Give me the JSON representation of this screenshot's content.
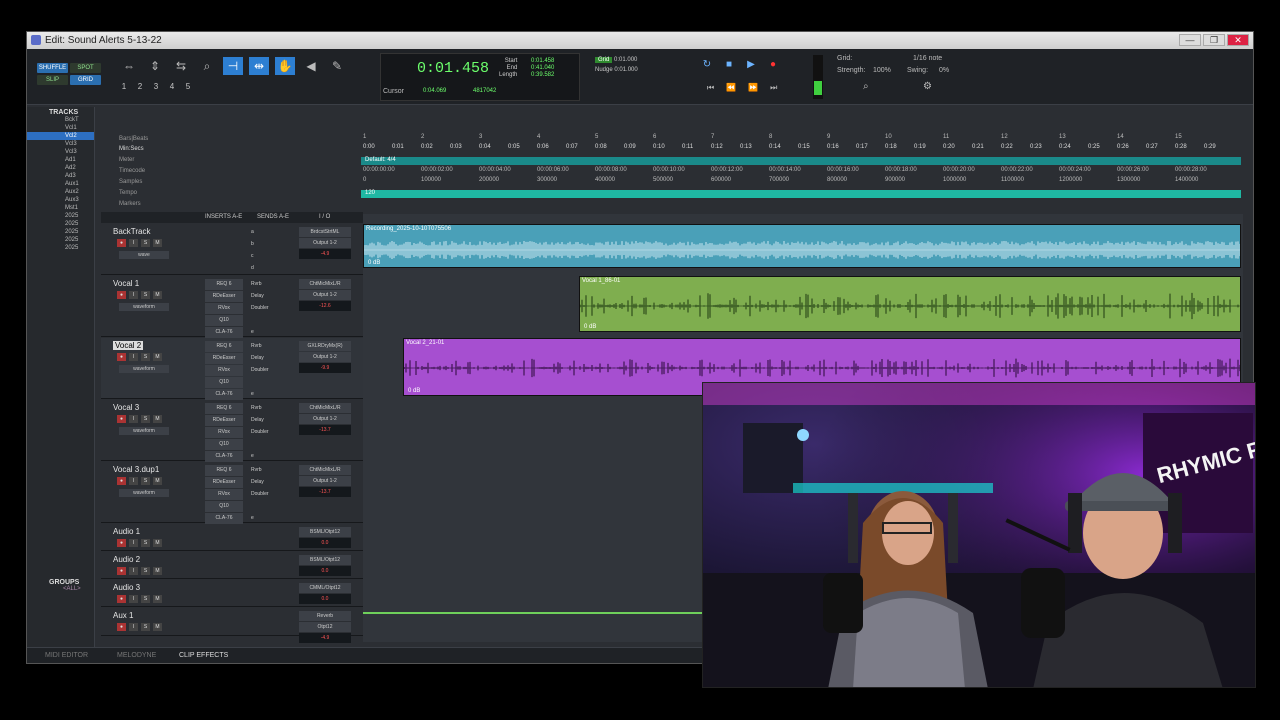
{
  "window": {
    "title": "Edit: Sound Alerts 5-13-22",
    "controls": [
      "—",
      "❐",
      "✕"
    ]
  },
  "toolbar": {
    "modes": [
      "SHUFFLE",
      "SPOT",
      "SLIP",
      "GRID"
    ],
    "main_counter": "0:01.458",
    "cursor_label": "Cursor",
    "cursor_value": "0:04.069",
    "cursor_sample": "4817042",
    "selection_labels": [
      "Start",
      "End",
      "Length"
    ],
    "selection_values": [
      "0:01.458",
      "0:41.040",
      "0:39.582"
    ],
    "grid_label": "Grid",
    "grid_value": "0:01.000",
    "nudge_label": "Nudge",
    "nudge_value": "0:01.000",
    "quick_grid": "Grid:",
    "note_value": "1/16 note",
    "strength_label": "Strength:",
    "strength_value": "100%",
    "swing_label": "Swing:",
    "swing_value": "0%",
    "zoom_presets": [
      "1",
      "2",
      "3",
      "4",
      "5"
    ]
  },
  "tracks_panel": {
    "title": "TRACKS",
    "items": [
      "BckT",
      "Vcl1",
      "Vcl2",
      "Vcl3",
      "Vcl3",
      "Ad1",
      "Ad2",
      "Ad3",
      "Aux1",
      "Aux2",
      "Aux3",
      "Mst1",
      "2025",
      "2025",
      "2025",
      "2025",
      "2025"
    ],
    "groups_title": "GROUPS",
    "groups_all": "<ALL>"
  },
  "rulers": {
    "labels": [
      "Bars|Beats",
      "Min:Secs",
      "Meter",
      "Timecode",
      "Samples",
      "Tempo",
      "Markers"
    ],
    "meter_value": "Default: 4/4",
    "tempo_value": "120",
    "bars": [
      "1",
      "2",
      "3",
      "4",
      "5",
      "6",
      "7",
      "8",
      "9",
      "10",
      "11",
      "12",
      "13",
      "14",
      "15"
    ],
    "minsecs": [
      "0:00",
      "0:01",
      "0:02",
      "0:03",
      "0:04",
      "0:05",
      "0:06",
      "0:07",
      "0:08",
      "0:09",
      "0:10",
      "0:11",
      "0:12",
      "0:13",
      "0:14",
      "0:15",
      "0:16",
      "0:17",
      "0:18",
      "0:19",
      "0:20",
      "0:21",
      "0:22",
      "0:23",
      "0:24",
      "0:25",
      "0:26",
      "0:27",
      "0:28",
      "0:29"
    ],
    "timecode": [
      "00:00:00:00",
      "00:00:02:00",
      "00:00:04:00",
      "00:00:06:00",
      "00:00:08:00",
      "00:00:10:00",
      "00:00:12:00",
      "00:00:14:00",
      "00:00:16:00",
      "00:00:18:00",
      "00:00:20:00",
      "00:00:22:00",
      "00:00:24:00",
      "00:00:26:00",
      "00:00:28:00"
    ],
    "samples": [
      "0",
      "100000",
      "200000",
      "300000",
      "400000",
      "500000",
      "600000",
      "700000",
      "800000",
      "900000",
      "1000000",
      "1100000",
      "1200000",
      "1300000",
      "1400000"
    ]
  },
  "mix_header": {
    "inserts": "INSERTS A-E",
    "sends": "SENDS A-E",
    "io": "I / O"
  },
  "tracks": [
    {
      "name": "BackTrack",
      "view": "wave",
      "inserts": [],
      "sends": [
        "a",
        "b",
        "c",
        "d"
      ],
      "io": [
        "BrdcstStrtML",
        "Output 1-2"
      ],
      "vol": "-4.9",
      "pan": "100 100"
    },
    {
      "name": "Vocal 1",
      "view": "waveform",
      "auto": "dyn read",
      "inserts": [
        "REQ 6",
        "RDeEsser",
        "RVox",
        "Q10",
        "CLA-76"
      ],
      "sends": [
        "Rvrb",
        "Delay",
        "Doubler",
        "",
        "e"
      ],
      "io": [
        "ChtMicMixL/R",
        "Output 1-2"
      ],
      "vol": "-12.6",
      "pan": "100 100"
    },
    {
      "name": "Vocal 2",
      "view": "waveform",
      "auto": "dyn read",
      "inserts": [
        "REQ 6",
        "RDeEsser",
        "RVox",
        "Q10",
        "CLA-76"
      ],
      "sends": [
        "Rvrb",
        "Delay",
        "Doubler",
        "",
        "e"
      ],
      "io": [
        "GXLRDryMx(R)",
        "Output 1-2"
      ],
      "vol": "-9.9",
      "pan": "pan"
    },
    {
      "name": "Vocal 3",
      "view": "waveform",
      "auto": "dyn read",
      "inserts": [
        "REQ 6",
        "RDeEsser",
        "RVox",
        "Q10",
        "CLA-76"
      ],
      "sends": [
        "Rvrb",
        "Delay",
        "Doubler",
        "",
        "e"
      ],
      "io": [
        "ChtMicMixL/R",
        "Output 1-2"
      ],
      "vol": "-13.7",
      "pan": "100 100"
    },
    {
      "name": "Vocal 3.dup1",
      "view": "waveform",
      "auto": "dyn read",
      "inserts": [
        "REQ 6",
        "RDeEsser",
        "RVox",
        "Q10",
        "CLA-76"
      ],
      "sends": [
        "Rvrb",
        "Delay",
        "Doubler",
        "",
        "e"
      ],
      "io": [
        "ChtMicMixL/R",
        "Output 1-2"
      ],
      "vol": "-13.7",
      "pan": "100 100"
    },
    {
      "name": "Audio 1",
      "view": "wave",
      "io": [
        "BSML/Otpt12"
      ],
      "vol": "0.0"
    },
    {
      "name": "Audio 2",
      "view": "wave",
      "io": [
        "BSML/Otpt12"
      ],
      "vol": "0.0"
    },
    {
      "name": "Audio 3",
      "view": "wave",
      "io": [
        "CMML/Otpt12"
      ],
      "vol": "0.0"
    },
    {
      "name": "Aux 1",
      "view": "vol",
      "io": [
        "Reverb",
        "Otpt12"
      ],
      "vol": "-4.9"
    }
  ],
  "clips": [
    {
      "name": "Recording_2025-10-10T075506",
      "gain": "0 dB",
      "color": "#4aa0b8"
    },
    {
      "name": "Vocal 1_86-01",
      "gain": "0 dB",
      "color": "#7fae4f"
    },
    {
      "name": "Vocal 2_21-01",
      "gain": "0 dB",
      "color": "#a64fd0"
    }
  ],
  "bottom_tabs": [
    "MIDI EDITOR",
    "MELODYNE",
    "CLIP EFFECTS"
  ],
  "colors": {
    "accent": "#2d7fd2",
    "counter_green": "#6cff6c",
    "backtrack": "#4aa0b8",
    "vocal1": "#7fae4f",
    "vocal2": "#a64fd0"
  },
  "webcam": {
    "sign_text": "RHYMIC RADIO"
  }
}
